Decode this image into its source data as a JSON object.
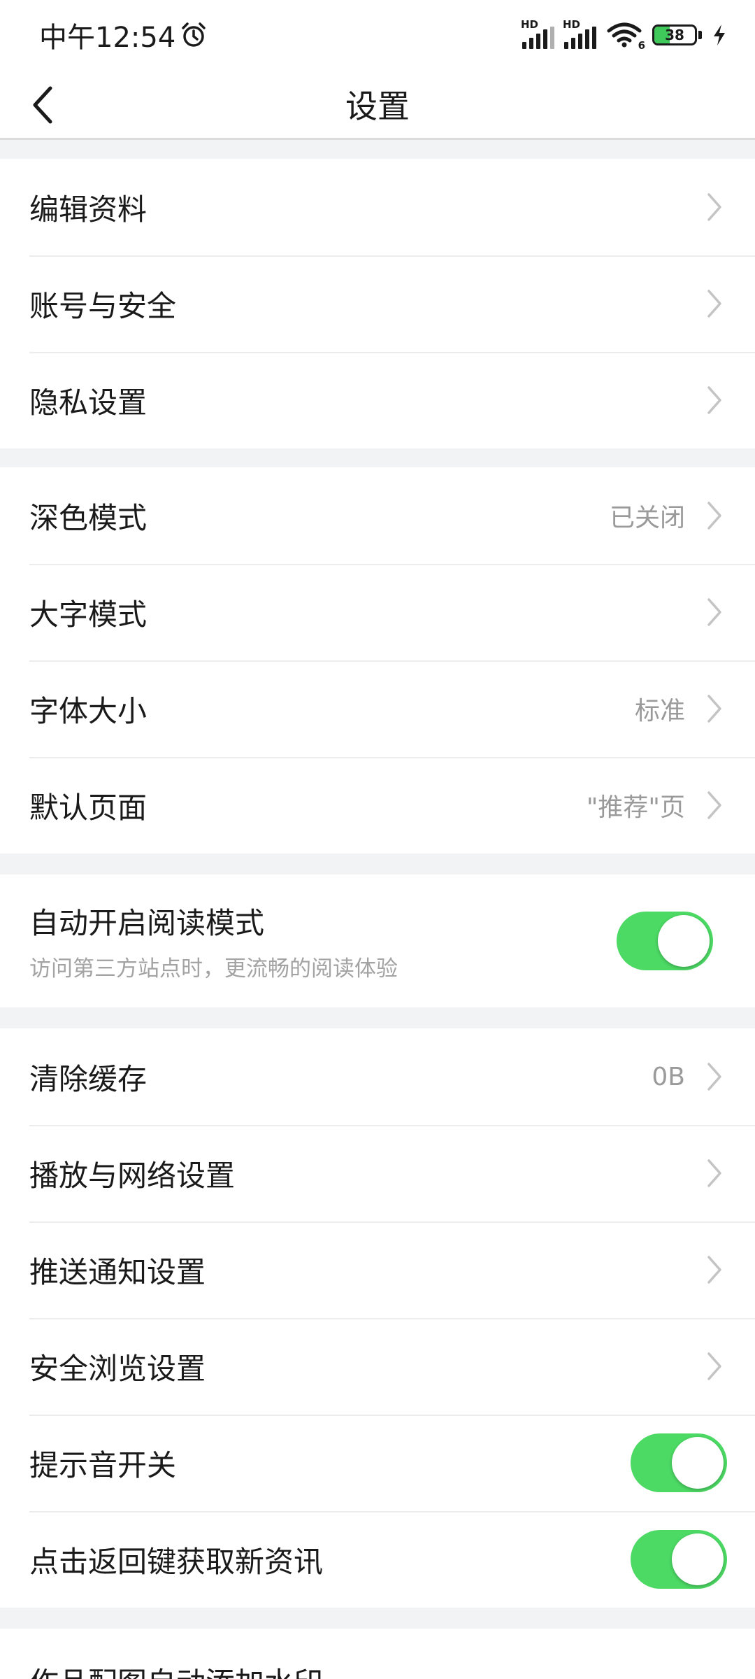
{
  "status_bar": {
    "time": "中午12:54",
    "network_badge_1": "HD",
    "network_badge_2": "HD",
    "wifi_badge": "6",
    "battery_level": "38",
    "battery_percent": 38
  },
  "header": {
    "title": "设置"
  },
  "groups": {
    "account": {
      "edit_profile": {
        "label": "编辑资料"
      },
      "account_security": {
        "label": "账号与安全"
      },
      "privacy": {
        "label": "隐私设置"
      }
    },
    "display": {
      "dark_mode": {
        "label": "深色模式",
        "value": "已关闭"
      },
      "large_text": {
        "label": "大字模式"
      },
      "font_size": {
        "label": "字体大小",
        "value": "标准"
      },
      "default_page": {
        "label": "默认页面",
        "value": "\"推荐\"页"
      }
    },
    "reading": {
      "auto_reader": {
        "label": "自动开启阅读模式",
        "subtitle": "访问第三方站点时，更流畅的阅读体验",
        "enabled": true
      }
    },
    "general": {
      "clear_cache": {
        "label": "清除缓存",
        "value": "0B"
      },
      "playback_network": {
        "label": "播放与网络设置"
      },
      "push_notifications": {
        "label": "推送通知设置"
      },
      "safe_browsing": {
        "label": "安全浏览设置"
      },
      "sound_toggle": {
        "label": "提示音开关",
        "enabled": true
      },
      "back_refresh": {
        "label": "点击返回键获取新资讯",
        "enabled": true
      }
    },
    "works": {
      "watermark": {
        "label": "作品配图自动添加水印",
        "enabled": false
      }
    }
  },
  "icons": {
    "back": "chevron-left-icon",
    "row_arrow": "chevron-right-icon",
    "alarm": "alarm-clock-icon",
    "wifi": "wifi-icon",
    "charging": "lightning-bolt-icon"
  },
  "colors": {
    "toggle_on": "#4cd964",
    "battery_fill": "#3ec95a",
    "secondary_text": "#9a9a9a"
  }
}
